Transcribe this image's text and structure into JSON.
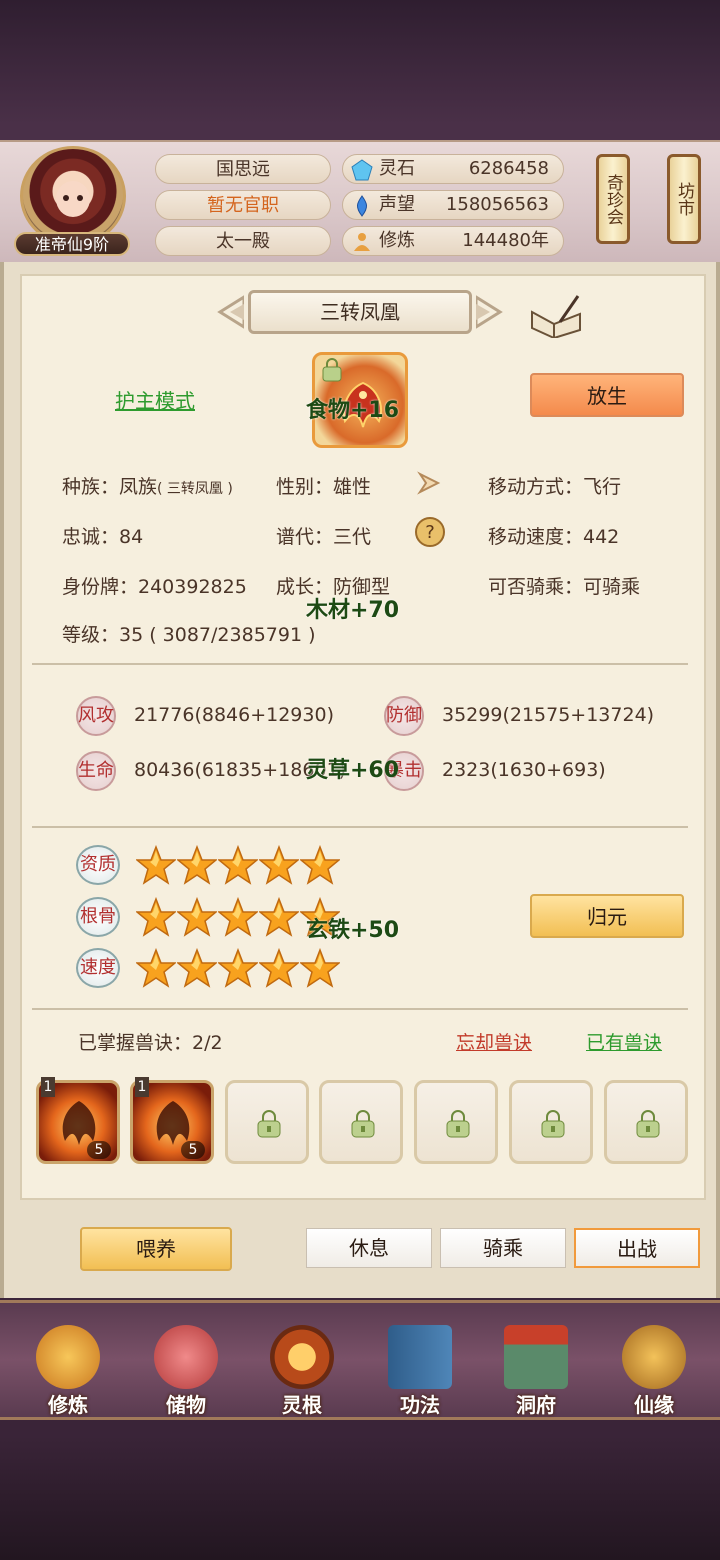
{
  "header": {
    "rank": "准帝仙9阶",
    "name": "国思远",
    "official_title": "暂无官职",
    "palace": "太一殿",
    "resources": [
      {
        "icon": "spirit-stone-icon",
        "label": "灵石",
        "value": "6286458"
      },
      {
        "icon": "prestige-icon",
        "label": "声望",
        "value": "158056563"
      },
      {
        "icon": "cultivation-icon",
        "label": "修炼",
        "value": "144480年"
      }
    ],
    "treasure_house": "奇珍会",
    "market": "坊市"
  },
  "pet": {
    "title": "三转凤凰",
    "guard_mode": "护主模式",
    "release": "放生",
    "attributes": {
      "race": "种族：凤族",
      "race_sub": "( 三转凤凰 )",
      "gender": "性别：雄性",
      "move_type": "移动方式：飞行",
      "loyalty": "忠诚：84",
      "generation": "谱代：三代",
      "move_speed": "移动速度：442",
      "id_tag": "身份牌：240392825",
      "growth": "成长：防御型",
      "rideable": "可否骑乘：可骑乘",
      "level": "等级：35 ( 3087/2385791 )"
    },
    "stats": [
      {
        "icon": "风攻",
        "value": "21776(8846+12930)"
      },
      {
        "icon": "防御",
        "value": "35299(21575+13724)"
      },
      {
        "icon": "生命",
        "value": "80436(61835+18601)"
      },
      {
        "icon": "暴击",
        "value": "2323(1630+693)"
      }
    ],
    "aptitudes": [
      {
        "label": "资质",
        "stars": 5
      },
      {
        "label": "根骨",
        "stars": 5
      },
      {
        "label": "速度",
        "stars": 5
      }
    ],
    "return_btn": "归元",
    "mastered": "已掌握兽诀：2/2",
    "forget_link": "忘却兽诀",
    "owned_link": "已有兽诀",
    "skills": [
      {
        "tier": "1",
        "level": "5"
      },
      {
        "tier": "1",
        "level": "5"
      }
    ]
  },
  "floating": [
    "食物+16",
    "木材+70",
    "灵草+60",
    "玄铁+50"
  ],
  "actions": {
    "feed": "喂养",
    "rest": "休息",
    "ride": "骑乘",
    "battle": "出战"
  },
  "nav": [
    {
      "label": "修炼",
      "icon": "cultivate-icon"
    },
    {
      "label": "储物",
      "icon": "storage-bag-icon"
    },
    {
      "label": "灵根",
      "icon": "spirit-root-icon"
    },
    {
      "label": "功法",
      "icon": "technique-book-icon"
    },
    {
      "label": "洞府",
      "icon": "cave-mansion-icon"
    },
    {
      "label": "仙缘",
      "icon": "immortal-fate-icon"
    }
  ],
  "colors": {
    "accent_green": "#2e9b2e",
    "accent_red": "#c23b2a",
    "btn_orange": "#f48a4c",
    "btn_gold": "#f2bf53"
  }
}
